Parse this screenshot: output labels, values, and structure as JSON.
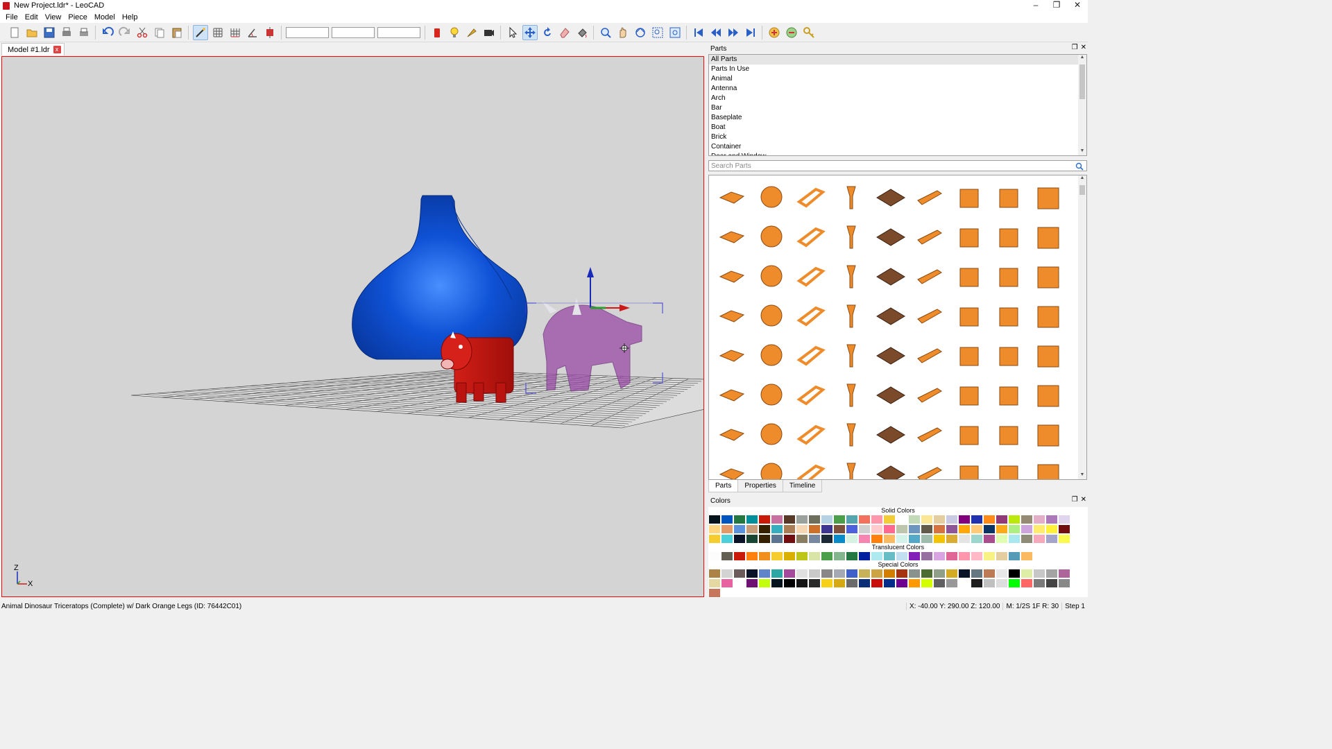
{
  "window": {
    "title": "New Project.ldr* - LeoCAD",
    "minimize_glyph": "–",
    "maximize_glyph": "❐",
    "close_glyph": "✕"
  },
  "menu": [
    "File",
    "Edit",
    "View",
    "Piece",
    "Model",
    "Help"
  ],
  "toolbar": {
    "groups": [
      [
        "new-icon",
        "open-icon",
        "save-icon",
        "print-icon",
        "print-preview-icon"
      ],
      [
        "undo-icon",
        "redo-icon",
        "cut-icon",
        "copy-icon",
        "paste-icon"
      ],
      [
        "relative-transform-icon",
        "snap-grid-icon",
        "snap-grid-icon-2",
        "snap-angle-icon",
        "snap-move-icon"
      ],
      [
        "input",
        "input",
        "input"
      ],
      [
        "brick-icon",
        "light-icon",
        "spotlight-icon",
        "camera-icon"
      ],
      [
        "select-icon",
        "move-icon",
        "rotate-icon",
        "delete-icon",
        "paint-icon"
      ],
      [
        "zoom-icon",
        "pan-icon",
        "rotate-view-icon",
        "zoom-region-icon",
        "zoom-extents-icon"
      ],
      [
        "first-step-icon",
        "previous-step-icon",
        "next-step-icon",
        "last-step-icon"
      ],
      [
        "insert-step-icon",
        "remove-step-icon",
        "key-icon"
      ]
    ],
    "active": [
      "relative-transform-icon",
      "move-icon"
    ]
  },
  "document_tab": {
    "label": "Model #1.ldr",
    "close": "x"
  },
  "viewport": {
    "axis_z": "Z",
    "axis_x": "X"
  },
  "parts_panel": {
    "title": "Parts",
    "categories": [
      "All Parts",
      "Parts In Use",
      "Animal",
      "Antenna",
      "Arch",
      "Bar",
      "Baseplate",
      "Boat",
      "Brick",
      "Container",
      "Door and Window"
    ],
    "selected_category": "All Parts",
    "search_placeholder": "Search Parts",
    "tabs": [
      "Parts",
      "Properties",
      "Timeline"
    ],
    "active_tab": "Parts",
    "part_color": "#ee8c2c"
  },
  "colors_panel": {
    "title": "Colors",
    "sections": [
      {
        "label": "Solid Colors",
        "rows": [
          [
            "#05131d",
            "#0055bf",
            "#237841",
            "#008f9b",
            "#c91a09",
            "#c870a0",
            "#583927",
            "#9ba19d",
            "#6d6e5c",
            "#b4d2e3",
            "#4b9f4a",
            "#55a5af",
            "#f2705e",
            "#fc97ac",
            "#f2cd37",
            "#ffffff",
            "#c2dab8",
            "#fbe696",
            "#e4cd9e",
            "#c9cae2",
            "#81007b",
            "#2032b0",
            "#fe8a18",
            "#923978",
            "#bbe90b",
            "#958a73",
            "#e4adc8",
            "#ac78ba",
            "#e1d5ed"
          ],
          [
            "#ffd67f",
            "#e39a68",
            "#5a93db",
            "#c89d79",
            "#352100",
            "#36aebf",
            "#aa7d55",
            "#f6d7b3",
            "#cc702a",
            "#3f3691",
            "#7c503a",
            "#4c61db",
            "#d0d0d0",
            "#feccce",
            "#ff698f",
            "#bdc6ad",
            "#6c96bf",
            "#645a4c",
            "#d67240",
            "#8e5597",
            "#ffa70b",
            "#ffcb78",
            "#0a3463",
            "#fbab18",
            "#aeef84",
            "#cda4de",
            "#ffec6c",
            "#fff03a",
            "#720e0f"
          ],
          [
            "#f5cd2f",
            "#4cd0d9",
            "#0a1327",
            "#184632",
            "#352100",
            "#5b7590",
            "#720e0f",
            "#897d62",
            "#7988a1",
            "#1b2a34",
            "#078bc9",
            "#d5f2e2",
            "#f785b1",
            "#ff800d",
            "#f9ba61",
            "#d3f2ea",
            "#54a9c8",
            "#a0bcac",
            "#f3c305",
            "#dbac34",
            "#e4e4e4",
            "#9cd6cc",
            "#aa4d8e",
            "#e0ffb0",
            "#aae8ef",
            "#8e8c78",
            "#f6a9bb",
            "#a5a5cb",
            "#fafa4f"
          ]
        ]
      },
      {
        "label": "Translucent Colors",
        "rows": [
          [
            "#fcfcfc",
            "#635f52",
            "#c91a09",
            "#ff800d",
            "#f08f1c",
            "#f5cd2f",
            "#dab000",
            "#bdc618",
            "#d9e4a7",
            "#4b9f4a",
            "#84b68d",
            "#237841",
            "#0020a0",
            "#aee9ef",
            "#68bcc5",
            "#c1dff0",
            "#8320b7",
            "#96709f",
            "#d9a4e2",
            "#df6695",
            "#fc97ac",
            "#ffb8c6",
            "#f8f184",
            "#e4cd9e",
            "#559ab7",
            "#f9ba61"
          ]
        ]
      },
      {
        "label": "Special Colors",
        "rows": [
          [
            "#ac8247",
            "#d3d3d3",
            "#6b5a5a",
            "#0a1327",
            "#5f84c9",
            "#2ba8a4",
            "#a5499c",
            "#e0e0e0",
            "#c9c9c9",
            "#898788",
            "#a5a9b4",
            "#4061c9",
            "#c7b259",
            "#cda444",
            "#d27f00",
            "#a5330f",
            "#8a928d",
            "#4c6c33",
            "#90a088",
            "#d3ac23",
            "#0a1327",
            "#657780",
            "#bc7a55",
            "#e8e8e8",
            "#000000",
            "#dfeea5",
            "#c7c7c7",
            "#a4a4a4",
            "#ad659a"
          ],
          [
            "#e4d9a2",
            "#e862a1",
            "#ffffff",
            "#6e1173",
            "#c3ff0c",
            "#05131d",
            "#000000",
            "#141414",
            "#2a2a2a",
            "#f7d117",
            "#d4a913",
            "#6b6b6b",
            "#0c2e76",
            "#c90e0e",
            "#032d88",
            "#6d0091",
            "#ff9900",
            "#d3ff00",
            "#606060",
            "#989898",
            "#ffffff",
            "#1e1e1e",
            "#c0c0c0",
            "#dddddd",
            "#00ff00",
            "#ff6666",
            "#7a7a7a",
            "#444444",
            "#888888"
          ],
          [
            "#c7765c"
          ]
        ]
      }
    ]
  },
  "status": {
    "message": "Animal Dinosaur Triceratops (Complete) w/ Dark Orange Legs (ID: 76442C01)",
    "coords": "X: -40.00 Y: 290.00 Z: 120.00",
    "snap": "M: 1/2S 1F R: 30",
    "step": "Step 1"
  }
}
